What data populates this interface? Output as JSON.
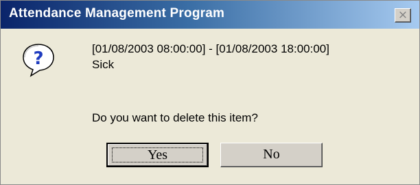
{
  "window": {
    "title": "Attendance Management Program",
    "close_symbol": "×",
    "close_icon": "close-icon"
  },
  "message": {
    "icon": "question-icon",
    "time_range": "[01/08/2003 08:00:00] - [01/08/2003 18:00:00]",
    "reason": "Sick",
    "prompt": "Do you want to delete this item?"
  },
  "buttons": {
    "yes_label": "Yes",
    "no_label": "No"
  },
  "colors": {
    "titlebar_start": "#0a246a",
    "titlebar_end": "#a6caf0",
    "dialog_bg": "#ece9d8",
    "icon_blue": "#1f3cbf"
  }
}
